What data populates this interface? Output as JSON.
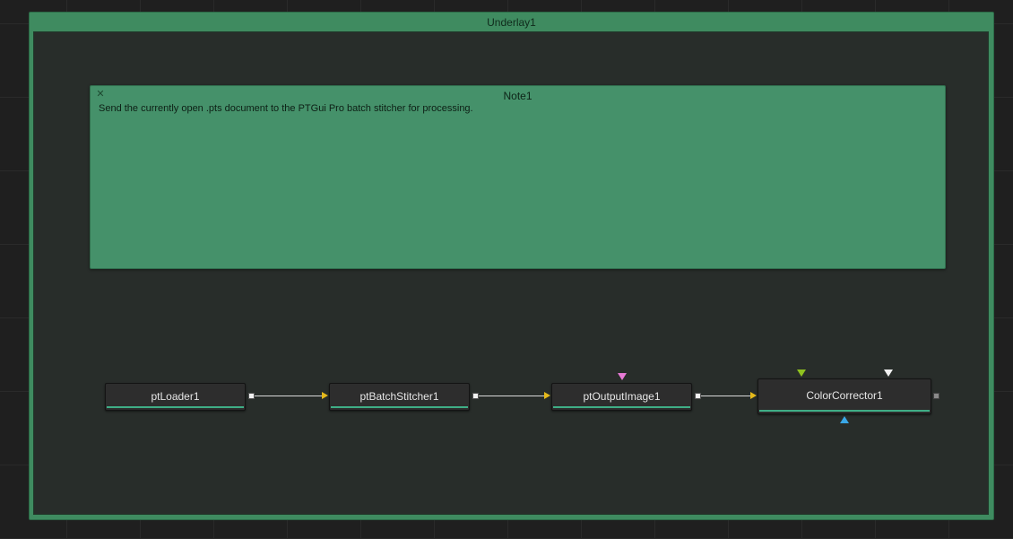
{
  "underlay": {
    "title": "Underlay1"
  },
  "note": {
    "title": "Note1",
    "text": "Send the currently open .pts document to the PTGui Pro batch stitcher for processing.",
    "close_icon": "close-icon"
  },
  "nodes": [
    {
      "label": "ptLoader1"
    },
    {
      "label": "ptBatchStitcher1"
    },
    {
      "label": "ptOutputImage1"
    },
    {
      "label": "ColorCorrector1"
    }
  ],
  "colors": {
    "underlay": "#3f8b60",
    "note": "#45916a",
    "node_bg": "#2d2d2d",
    "node_accent": "#3fae86",
    "input_arrow": "#e5b91a",
    "mask_input_pink": "#e87ad6",
    "input_green": "#8fc21f",
    "input_white": "#f0f0f0",
    "input_blue": "#3aa7e6"
  }
}
